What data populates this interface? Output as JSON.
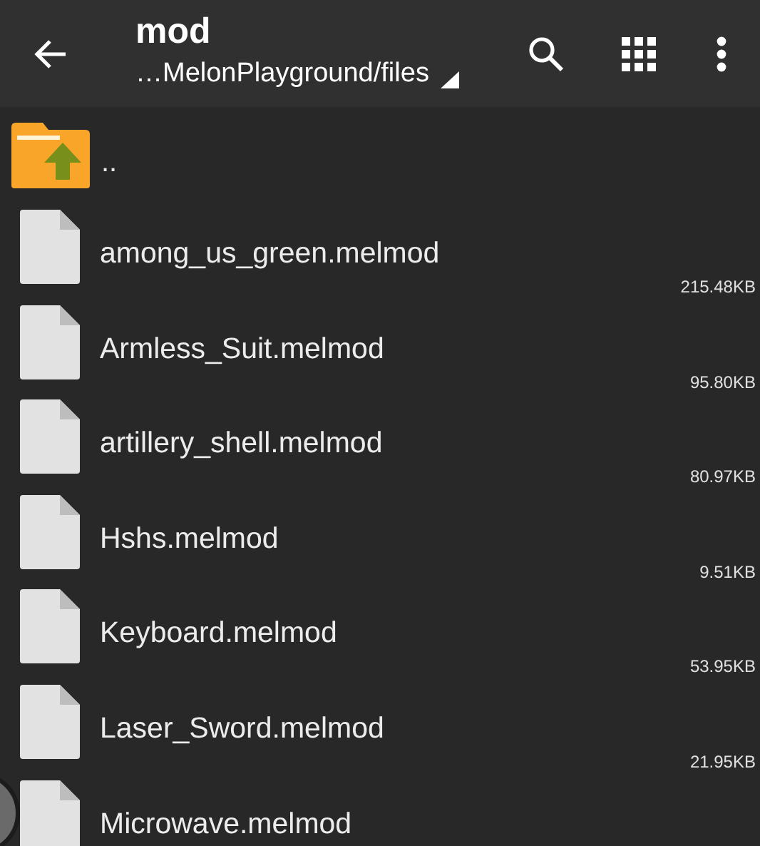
{
  "toolbar": {
    "title": "mod",
    "path": "…MelonPlayground/files"
  },
  "parent_entry": {
    "name": ".."
  },
  "files": [
    {
      "name": "among_us_green.melmod",
      "size": "215.48KB"
    },
    {
      "name": "Armless_Suit.melmod",
      "size": "95.80KB"
    },
    {
      "name": "artillery_shell.melmod",
      "size": "80.97KB"
    },
    {
      "name": "Hshs.melmod",
      "size": "9.51KB"
    },
    {
      "name": "Keyboard.melmod",
      "size": "53.95KB"
    },
    {
      "name": "Laser_Sword.melmod",
      "size": "21.95KB"
    },
    {
      "name": "Microwave.melmod"
    }
  ]
}
